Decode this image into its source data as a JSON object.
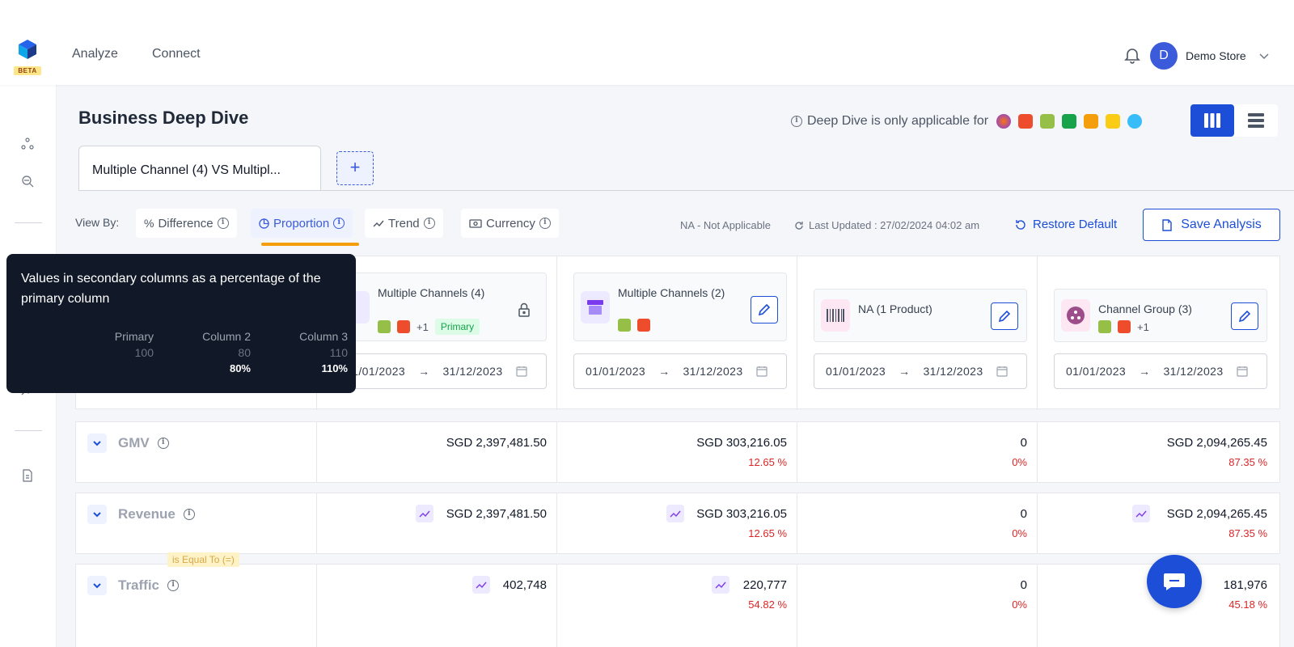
{
  "brand": {
    "beta": "BETA"
  },
  "nav": {
    "analyze": "Analyze",
    "connect": "Connect"
  },
  "user": {
    "initial": "D",
    "store": "Demo Store"
  },
  "page": {
    "title": "Business Deep Dive",
    "deep_dive_note": "Deep Dive is only applicable for",
    "tab_label": "Multiple Channel (4) VS Multipl...",
    "add_tab": "+"
  },
  "toolbar": {
    "view_by": "View By:",
    "difference": "Difference",
    "proportion": "Proportion",
    "trend": "Trend",
    "currency": "Currency",
    "na_note": "NA - Not Applicable",
    "last_updated": "Last Updated : 27/02/2024 04:02 am",
    "restore": "Restore Default",
    "save": "Save Analysis"
  },
  "columns": [
    {
      "title": "Multiple Channels (4)",
      "extra": "+1",
      "badge": "Primary",
      "start": "01/01/2023",
      "end": "31/12/2023"
    },
    {
      "title": "Multiple Channels (2)",
      "extra": "",
      "start": "01/01/2023",
      "end": "31/12/2023"
    },
    {
      "title": "NA (1 Product)",
      "extra": "",
      "start": "01/01/2023",
      "end": "31/12/2023"
    },
    {
      "title": "Channel Group (3)",
      "extra": "+1",
      "start": "01/01/2023",
      "end": "31/12/2023"
    }
  ],
  "metrics": [
    {
      "label": "GMV",
      "values": [
        "SGD 2,397,481.50",
        "SGD 303,216.05",
        "0",
        "SGD 2,094,265.45"
      ],
      "pcts": [
        "",
        "12.65 %",
        "0%",
        "87.35 %"
      ]
    },
    {
      "label": "Revenue",
      "values": [
        "SGD 2,397,481.50",
        "SGD 303,216.05",
        "0",
        "SGD 2,094,265.45"
      ],
      "pcts": [
        "",
        "12.65 %",
        "0%",
        "87.35 %"
      ]
    },
    {
      "label": "Traffic",
      "values": [
        "402,748",
        "220,777",
        "0",
        "181,976"
      ],
      "pcts": [
        "",
        "54.82 %",
        "0%",
        "45.18 %"
      ]
    }
  ],
  "filter_tag": "is Equal To (=)",
  "tooltip": {
    "text": "Values in secondary columns as a percentage of the primary column",
    "headers": [
      "Primary",
      "Column 2",
      "Column 3"
    ],
    "row1": [
      "100",
      "80",
      "110"
    ],
    "row2": [
      "",
      "80%",
      "110%"
    ]
  },
  "colors": {
    "accent": "#1d4ed8",
    "negative": "#dc2626",
    "highlight": "#f59e0b",
    "tooltip_bg": "#111827"
  }
}
